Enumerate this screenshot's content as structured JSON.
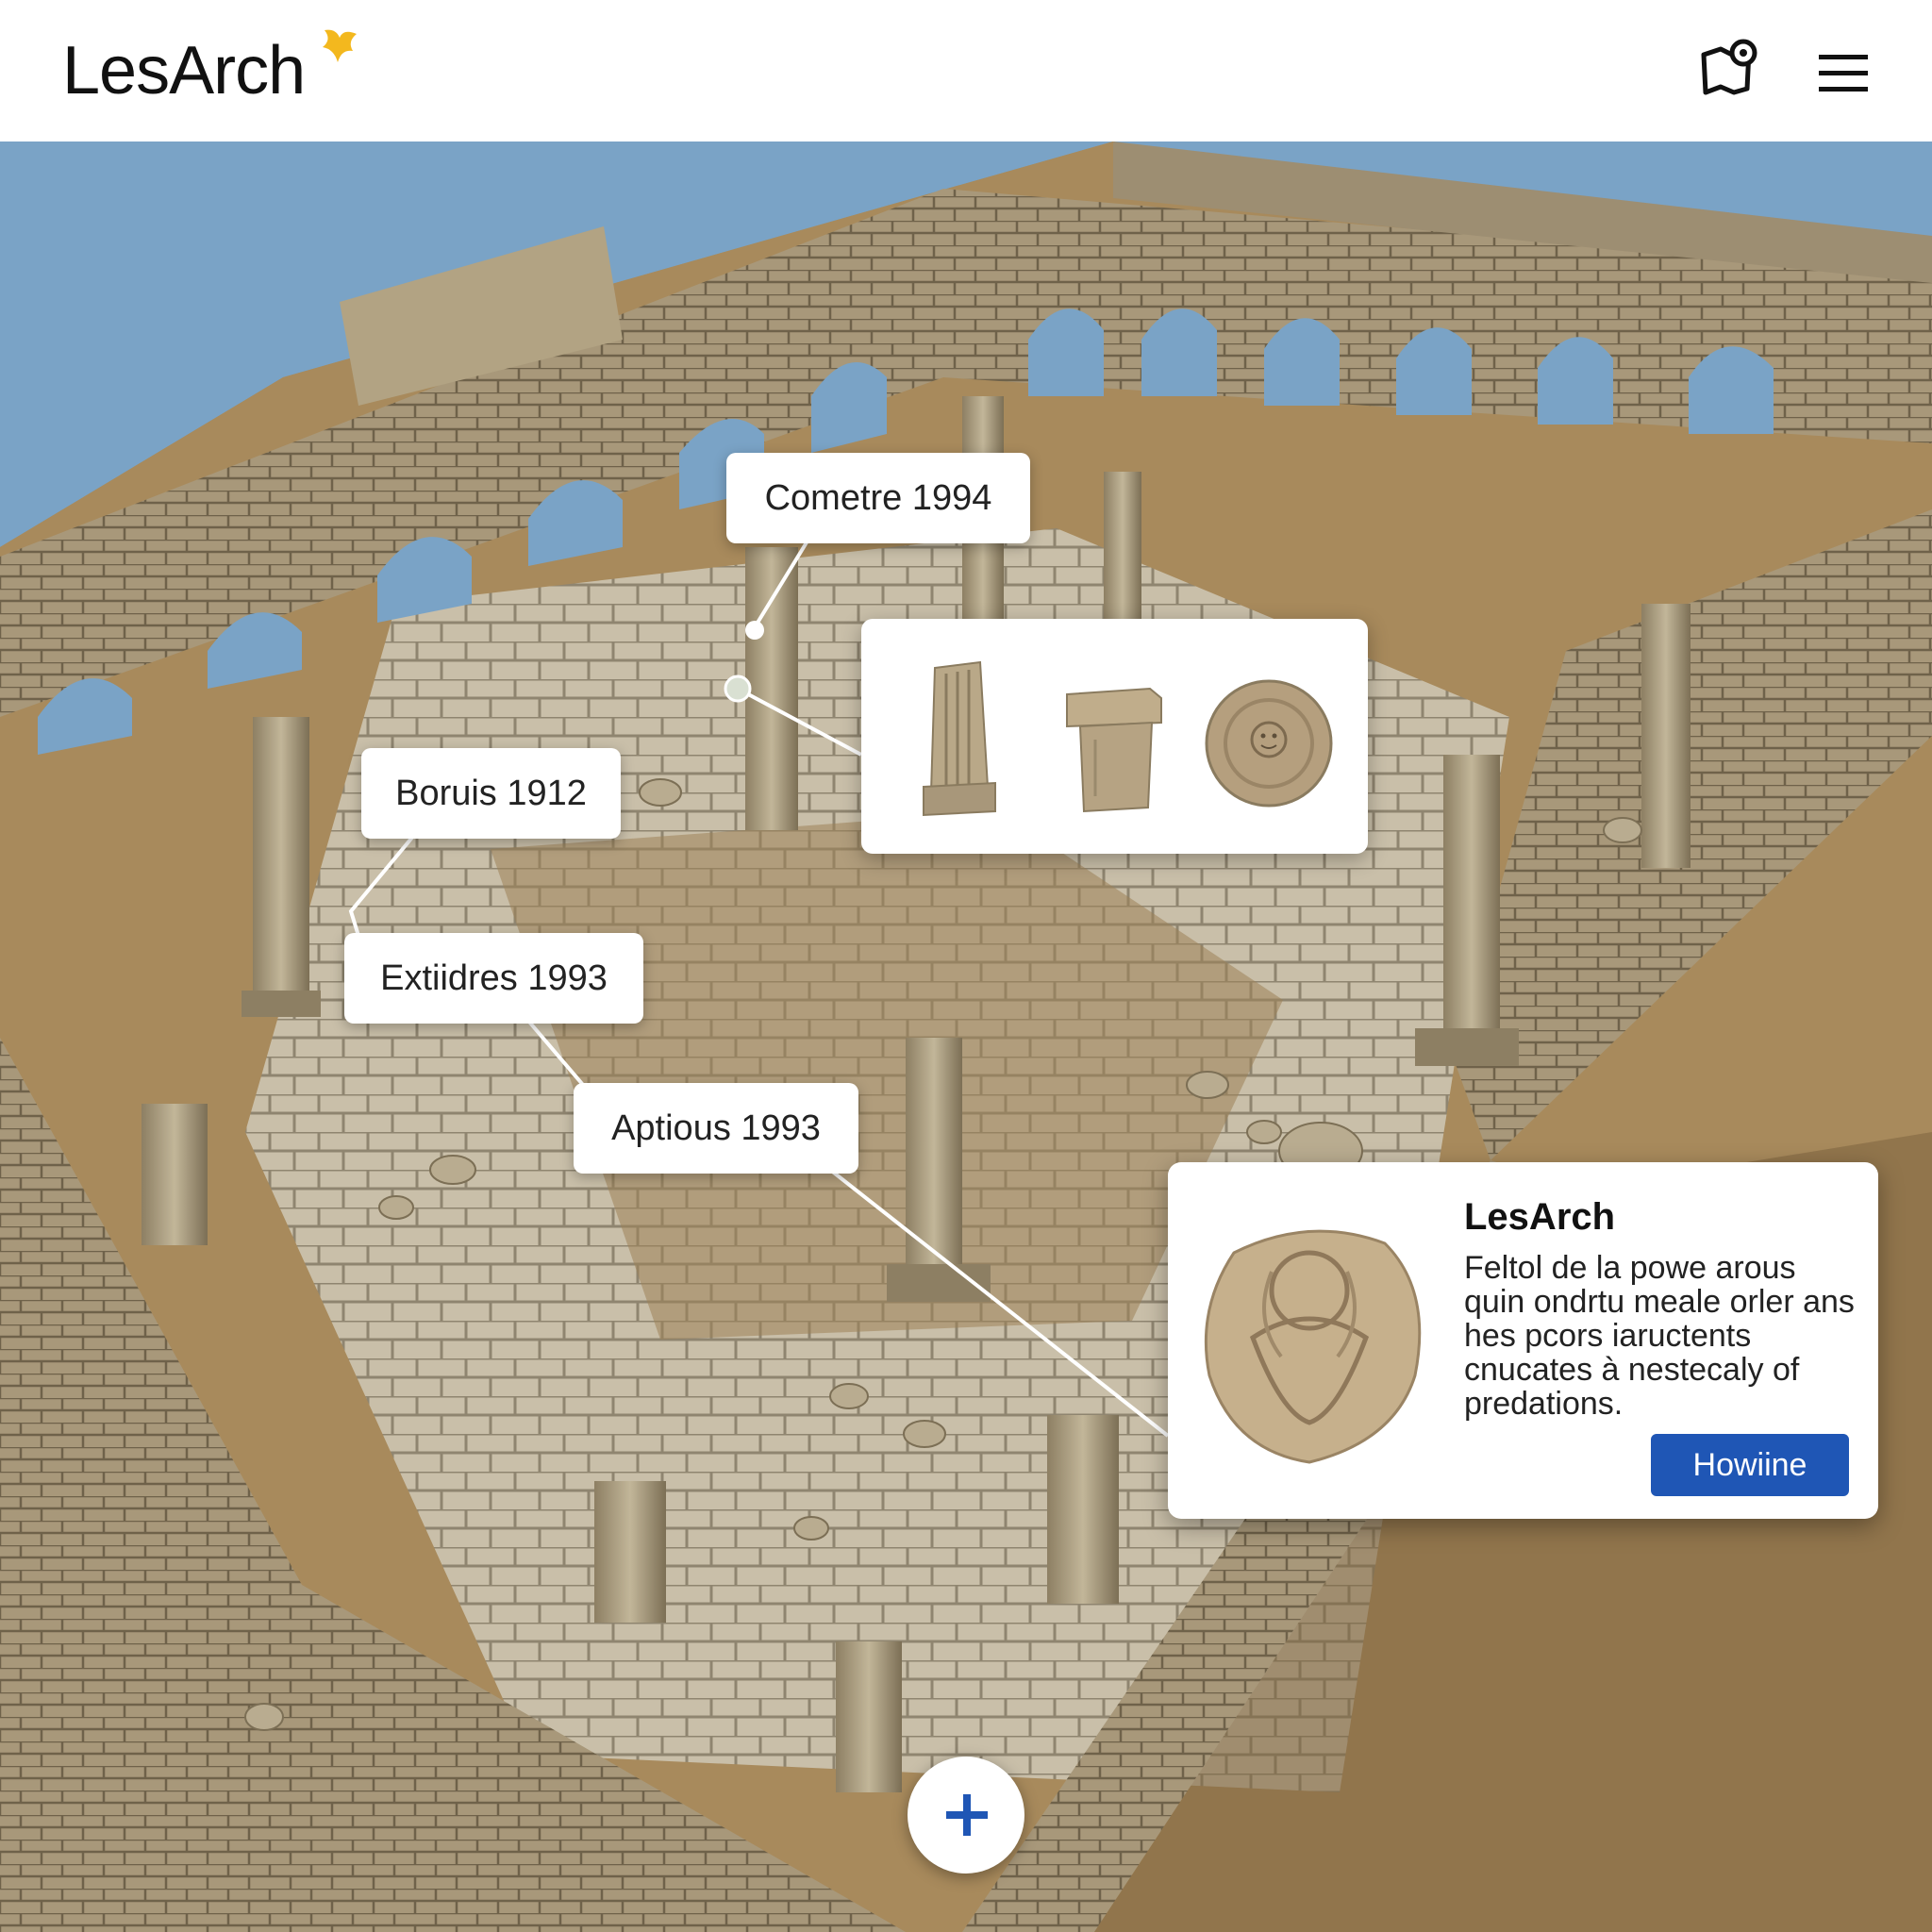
{
  "app": {
    "name": "LesArch"
  },
  "header": {
    "logo_text": "LesArch"
  },
  "markers": [
    {
      "label": "Cometre 1994"
    },
    {
      "label": "Boruis 1912"
    },
    {
      "label": "Extiidres 1993"
    },
    {
      "label": "Aptious 1993"
    }
  ],
  "artifact_gallery": {
    "items": [
      "column-fragment",
      "capital-block",
      "carved-disc"
    ]
  },
  "detail_card": {
    "title": "LesArch",
    "body": "Feltol de la powe arous quin ondrtu meale orler ans hes pcors iaructents cnucates à nestecaly of predations.",
    "button_label": "Howiine"
  },
  "colors": {
    "brand_accent": "#f3b81e",
    "button_primary": "#1f56b5",
    "sky": "#7aa3c6",
    "stone": "#a8987a",
    "ground": "#a88a5c"
  },
  "icons": {
    "map": "map-pin-icon",
    "menu": "hamburger-menu-icon",
    "add": "plus-icon"
  }
}
